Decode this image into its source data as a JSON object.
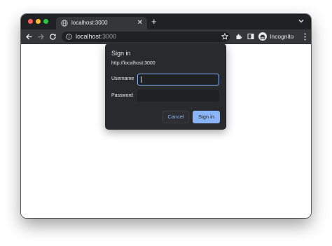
{
  "browser": {
    "tab": {
      "title": "localhost:3000",
      "close_glyph": "✕",
      "favicon": "globe-icon"
    },
    "new_tab_glyph": "+",
    "url": {
      "host": "localhost",
      "port": ":3000"
    },
    "profile_label": "Incognito",
    "icons": [
      "back-arrow-icon",
      "forward-arrow-icon",
      "reload-icon",
      "info-icon",
      "star-icon",
      "extensions-icon",
      "side-panel-icon",
      "incognito-icon",
      "kebab-menu-icon",
      "chevron-down-icon"
    ]
  },
  "dialog": {
    "title": "Sign in",
    "origin": "http://localhost:3000",
    "username_label": "Username",
    "username_value": "",
    "password_label": "Password",
    "password_value": "",
    "cancel_label": "Cancel",
    "signin_label": "Sign in"
  },
  "colors": {
    "accent": "#8ab4f8",
    "dialog_bg": "#292a2d",
    "toolbar_bg": "#35363a",
    "tabstrip_bg": "#202124"
  }
}
